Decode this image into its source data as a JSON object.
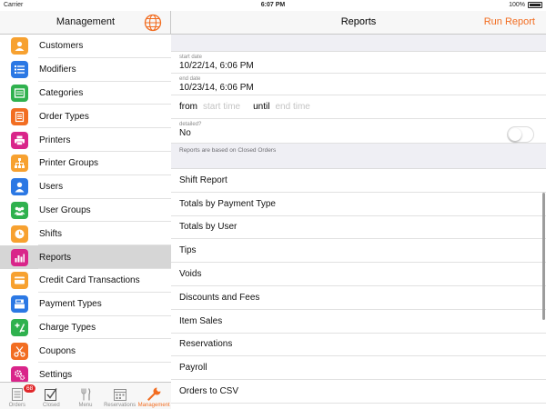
{
  "status_bar": {
    "carrier": "Carrier",
    "time": "6:07 PM",
    "battery": "100%"
  },
  "sidebar": {
    "title": "Management",
    "items": [
      {
        "label": "Customers",
        "icon": "person-icon",
        "color": "#f7a130"
      },
      {
        "label": "Modifiers",
        "icon": "list-icon",
        "color": "#2b78e4"
      },
      {
        "label": "Categories",
        "icon": "inbox-icon",
        "color": "#2fb14e"
      },
      {
        "label": "Order Types",
        "icon": "notepad-icon",
        "color": "#f26d21"
      },
      {
        "label": "Printers",
        "icon": "printer-icon",
        "color": "#d9258a"
      },
      {
        "label": "Printer Groups",
        "icon": "hierarchy-icon",
        "color": "#f7a130"
      },
      {
        "label": "Users",
        "icon": "user-icon",
        "color": "#2b78e4"
      },
      {
        "label": "User Groups",
        "icon": "group-icon",
        "color": "#2fb14e"
      },
      {
        "label": "Shifts",
        "icon": "clock-icon",
        "color": "#f7a130"
      },
      {
        "label": "Reports",
        "icon": "bar-chart-icon",
        "color": "#d9258a"
      },
      {
        "label": "Credit Card Transactions",
        "icon": "credit-card-icon",
        "color": "#f7a130"
      },
      {
        "label": "Payment Types",
        "icon": "register-icon",
        "color": "#2b78e4"
      },
      {
        "label": "Charge Types",
        "icon": "plus-minus-icon",
        "color": "#2fb14e"
      },
      {
        "label": "Coupons",
        "icon": "scissors-icon",
        "color": "#f26d21"
      },
      {
        "label": "Settings",
        "icon": "gears-icon",
        "color": "#d9258a"
      }
    ],
    "selected_index": 9
  },
  "tabbar": {
    "tabs": [
      {
        "label": "Orders",
        "icon": "orders-icon"
      },
      {
        "label": "Closed",
        "icon": "checkbox-icon"
      },
      {
        "label": "Menu",
        "icon": "fork-knife-icon"
      },
      {
        "label": "Reservations",
        "icon": "calendar-icon"
      },
      {
        "label": "Management",
        "icon": "wrench-icon"
      }
    ],
    "orders_badge": "68",
    "active": "Management"
  },
  "main": {
    "title": "Reports",
    "run_report": "Run Report",
    "start_date_label": "start date",
    "start_date_value": "10/22/14, 6:06 PM",
    "end_date_label": "end date",
    "end_date_value": "10/23/14, 6:06 PM",
    "from_label": "from",
    "start_time_placeholder": "start time",
    "until_label": "until",
    "end_time_placeholder": "end time",
    "detailed_label": "detailed?",
    "detailed_value": "No",
    "note": "Reports are based on Closed Orders",
    "reports": [
      "Shift Report",
      "Totals by Payment Type",
      "Totals by User",
      "Tips",
      "Voids",
      "Discounts and Fees",
      "Item Sales",
      "Reservations",
      "Payroll",
      "Orders to CSV"
    ]
  },
  "colors": {
    "accent": "#f26d21",
    "badge": "#e0282b"
  }
}
